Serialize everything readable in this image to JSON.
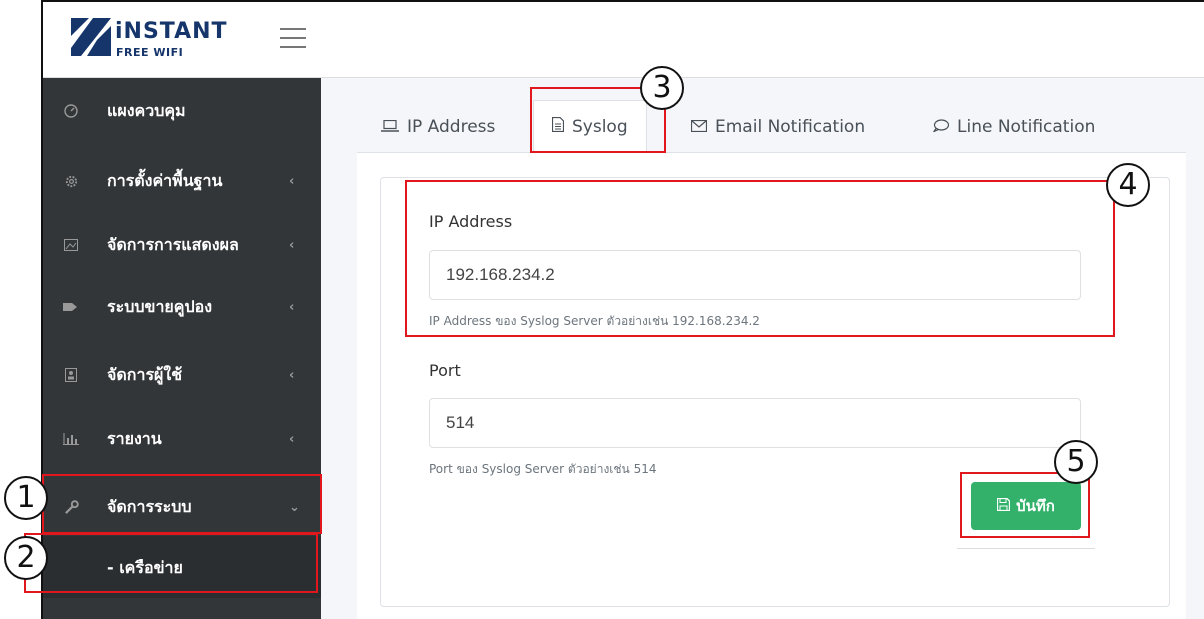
{
  "brand": {
    "title": "iNSTANT",
    "subtitle": "FREE WIFI",
    "color": "#15356b"
  },
  "header": {
    "menu_icon": "hamburger-icon"
  },
  "sidebar": {
    "items": [
      {
        "label": "แผงควบคุม",
        "icon": "dashboard-icon",
        "has_children": false
      },
      {
        "label": "การตั้งค่าพื้นฐาน",
        "icon": "gear-icon",
        "has_children": true
      },
      {
        "label": "จัดการการแสดงผล",
        "icon": "image-icon",
        "has_children": true
      },
      {
        "label": "ระบบขายคูปอง",
        "icon": "tag-icon",
        "has_children": true
      },
      {
        "label": "จัดการผู้ใช้",
        "icon": "user-card-icon",
        "has_children": true
      },
      {
        "label": "รายงาน",
        "icon": "bar-chart-icon",
        "has_children": true
      },
      {
        "label": "จัดการระบบ",
        "icon": "wrench-icon",
        "has_children": true,
        "expanded": true
      }
    ],
    "subitem": {
      "label": "- เครือข่าย"
    }
  },
  "tabs": [
    {
      "label": "IP Address",
      "icon": "laptop-icon",
      "active": false
    },
    {
      "label": "Syslog",
      "icon": "document-icon",
      "active": true
    },
    {
      "label": "Email Notification",
      "icon": "envelope-icon",
      "active": false
    },
    {
      "label": "Line Notification",
      "icon": "chat-bubble-icon",
      "active": false
    }
  ],
  "form": {
    "ip": {
      "label": "IP Address",
      "value": "192.168.234.2",
      "help": "IP Address ของ Syslog Server ตัวอย่างเช่น 192.168.234.2"
    },
    "port": {
      "label": "Port",
      "value": "514",
      "help": "Port ของ Syslog Server ตัวอย่างเช่น 514"
    },
    "save_label": "บันทึก"
  },
  "callouts": [
    "1",
    "2",
    "3",
    "4",
    "5"
  ],
  "colors": {
    "sidebar_bg": "#323639",
    "save_button": "#33b16a",
    "callout_border": "#e0171d"
  }
}
